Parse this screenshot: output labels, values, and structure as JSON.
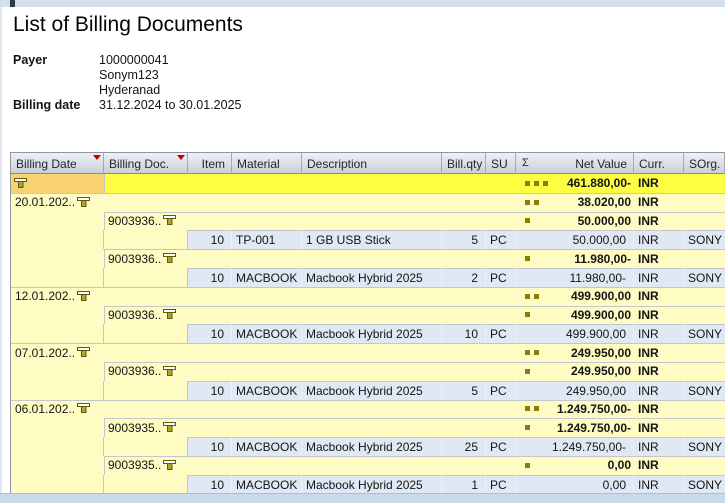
{
  "window": {
    "title": "List of Billing Documents",
    "payer_label": "Payer",
    "payer_lines": [
      "1000000041",
      "Sonym123",
      "Hyderanad"
    ],
    "billing_date_label": "Billing date",
    "billing_date_value": "31.12.2024 to 30.01.2025"
  },
  "table": {
    "columns": [
      {
        "label": "Billing Date",
        "sorted": true
      },
      {
        "label": "Billing Doc.",
        "sorted": true
      },
      {
        "label": "Item"
      },
      {
        "label": "Material"
      },
      {
        "label": "Description"
      },
      {
        "label": "Bill.qty"
      },
      {
        "label": "SU"
      },
      {
        "label": "Net Value",
        "sum_symbol": "Σ"
      },
      {
        "label": "Curr."
      },
      {
        "label": "SOrg."
      }
    ],
    "rows": [
      {
        "type": "grand_total",
        "sum_level": 3,
        "net_value": "461.880,00-",
        "currency": "INR"
      },
      {
        "type": "date_subtotal",
        "label": "20.01.202..",
        "sum_level": 2,
        "net_value": "38.020,00",
        "currency": "INR"
      },
      {
        "type": "doc_subtotal",
        "label": "9003936..",
        "sum_level": 1,
        "net_value": "50.000,00",
        "currency": "INR"
      },
      {
        "type": "item",
        "item": "10",
        "material": "TP-001",
        "description": "1 GB USB Stick",
        "qty": "5",
        "su": "PC",
        "net_value": "50.000,00",
        "currency": "INR",
        "sorg": "SONY"
      },
      {
        "type": "doc_subtotal",
        "label": "9003936..",
        "sum_level": 1,
        "net_value": "11.980,00-",
        "currency": "INR"
      },
      {
        "type": "item",
        "item": "10",
        "material": "MACBOOK",
        "description": "Macbook Hybrid 2025",
        "qty": "2",
        "su": "PC",
        "net_value": "11.980,00-",
        "currency": "INR",
        "sorg": "SONY"
      },
      {
        "type": "date_subtotal",
        "label": "12.01.202..",
        "sum_level": 2,
        "net_value": "499.900,00",
        "currency": "INR"
      },
      {
        "type": "doc_subtotal",
        "label": "9003936..",
        "sum_level": 1,
        "net_value": "499.900,00",
        "currency": "INR"
      },
      {
        "type": "item",
        "item": "10",
        "material": "MACBOOK",
        "description": "Macbook Hybrid 2025",
        "qty": "10",
        "su": "PC",
        "net_value": "499.900,00",
        "currency": "INR",
        "sorg": "SONY"
      },
      {
        "type": "date_subtotal",
        "label": "07.01.202..",
        "sum_level": 2,
        "net_value": "249.950,00",
        "currency": "INR"
      },
      {
        "type": "doc_subtotal",
        "label": "9003936..",
        "sum_level": 1,
        "net_value": "249.950,00",
        "currency": "INR"
      },
      {
        "type": "item",
        "item": "10",
        "material": "MACBOOK",
        "description": "Macbook Hybrid 2025",
        "qty": "5",
        "su": "PC",
        "net_value": "249.950,00",
        "currency": "INR",
        "sorg": "SONY"
      },
      {
        "type": "date_subtotal",
        "label": "06.01.202..",
        "sum_level": 2,
        "net_value": "1.249.750,00-",
        "currency": "INR"
      },
      {
        "type": "doc_subtotal",
        "label": "9003935..",
        "sum_level": 1,
        "net_value": "1.249.750,00-",
        "currency": "INR"
      },
      {
        "type": "item",
        "item": "10",
        "material": "MACBOOK",
        "description": "Macbook Hybrid 2025",
        "qty": "25",
        "su": "PC",
        "net_value": "1.249.750,00-",
        "currency": "INR",
        "sorg": "SONY"
      },
      {
        "type": "doc_subtotal",
        "label": "9003935..",
        "sum_level": 1,
        "net_value": "0,00",
        "currency": "INR"
      },
      {
        "type": "item",
        "item": "10",
        "material": "MACBOOK",
        "description": "Macbook Hybrid 2025",
        "qty": "1",
        "su": "PC",
        "net_value": "0,00",
        "currency": "INR",
        "sorg": "SONY"
      }
    ]
  },
  "colors": {
    "grand_total_row": "#fdfe42",
    "subtotal_row": "#fffcc3",
    "item_row": "#dfe8f3",
    "grand_total_date_cell": "#f9d271",
    "sort_icon_red": "#c20000",
    "sum_square": "#8a7d0c"
  }
}
